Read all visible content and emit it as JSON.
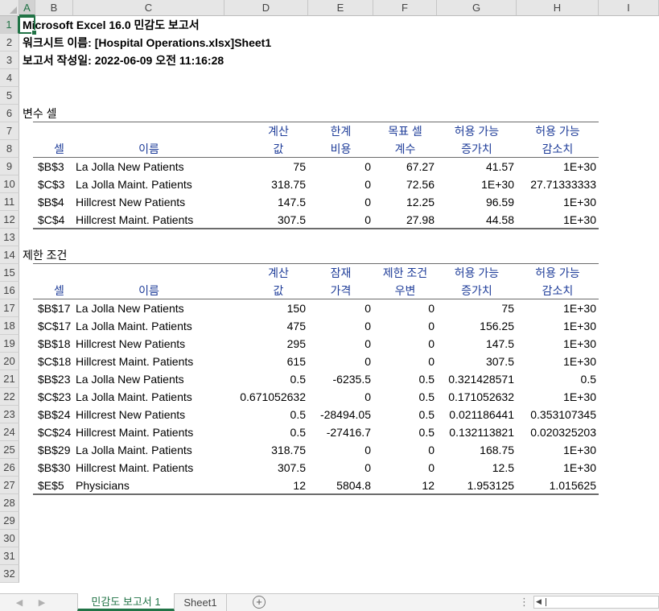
{
  "columns": [
    "A",
    "B",
    "C",
    "D",
    "E",
    "F",
    "G",
    "H",
    "I"
  ],
  "selected_column": "A",
  "selected_row": 1,
  "rows": [
    1,
    2,
    3,
    4,
    5,
    6,
    7,
    8,
    9,
    10,
    11,
    12,
    13,
    14,
    15,
    16,
    17,
    18,
    19,
    20,
    21,
    22,
    23,
    24,
    25,
    26,
    27,
    28,
    29,
    30,
    31,
    32
  ],
  "report": {
    "title": "Microsoft Excel 16.0 민감도 보고서",
    "worksheet": "워크시트 이름: [Hospital Operations.xlsx]Sheet1",
    "created": "보고서 작성일: 2022-06-09 오전 11:16:28"
  },
  "variable_cells": {
    "section_title": "변수 셀",
    "header_top": [
      "",
      "",
      "계산",
      "한계",
      "목표 셀",
      "허용 가능",
      "허용 가능"
    ],
    "header_bottom": [
      "셀",
      "이름",
      "값",
      "비용",
      "계수",
      "증가치",
      "감소치"
    ],
    "rows": [
      [
        "$B$3",
        "La Jolla New Patients",
        "75",
        "0",
        "67.27",
        "41.57",
        "1E+30"
      ],
      [
        "$C$3",
        "La Jolla Maint. Patients",
        "318.75",
        "0",
        "72.56",
        "1E+30",
        "27.71333333"
      ],
      [
        "$B$4",
        "Hillcrest New Patients",
        "147.5",
        "0",
        "12.25",
        "96.59",
        "1E+30"
      ],
      [
        "$C$4",
        "Hillcrest Maint. Patients",
        "307.5",
        "0",
        "27.98",
        "44.58",
        "1E+30"
      ]
    ]
  },
  "constraints": {
    "section_title": "제한 조건",
    "header_top": [
      "",
      "",
      "계산",
      "잠재",
      "제한 조건",
      "허용 가능",
      "허용 가능"
    ],
    "header_bottom": [
      "셀",
      "이름",
      "값",
      "가격",
      "우변",
      "증가치",
      "감소치"
    ],
    "rows": [
      [
        "$B$17",
        "La Jolla New Patients",
        "150",
        "0",
        "0",
        "75",
        "1E+30"
      ],
      [
        "$C$17",
        "La Jolla Maint. Patients",
        "475",
        "0",
        "0",
        "156.25",
        "1E+30"
      ],
      [
        "$B$18",
        "Hillcrest New Patients",
        "295",
        "0",
        "0",
        "147.5",
        "1E+30"
      ],
      [
        "$C$18",
        "Hillcrest Maint. Patients",
        "615",
        "0",
        "0",
        "307.5",
        "1E+30"
      ],
      [
        "$B$23",
        "La Jolla New Patients",
        "0.5",
        "-6235.5",
        "0.5",
        "0.321428571",
        "0.5"
      ],
      [
        "$C$23",
        "La Jolla Maint. Patients",
        "0.671052632",
        "0",
        "0.5",
        "0.171052632",
        "1E+30"
      ],
      [
        "$B$24",
        "Hillcrest New Patients",
        "0.5",
        "-28494.05",
        "0.5",
        "0.021186441",
        "0.353107345"
      ],
      [
        "$C$24",
        "Hillcrest Maint. Patients",
        "0.5",
        "-27416.7",
        "0.5",
        "0.132113821",
        "0.020325203"
      ],
      [
        "$B$29",
        "La Jolla Maint. Patients",
        "318.75",
        "0",
        "0",
        "168.75",
        "1E+30"
      ],
      [
        "$B$30",
        "Hillcrest Maint. Patients",
        "307.5",
        "0",
        "0",
        "12.5",
        "1E+30"
      ],
      [
        "$E$5",
        "Physicians",
        "12",
        "5804.8",
        "12",
        "1.953125",
        "1.015625"
      ]
    ]
  },
  "sheet_tabs": [
    {
      "label": "민감도 보고서 1",
      "active": true
    },
    {
      "label": "Sheet1",
      "active": false
    }
  ],
  "icons": {
    "nav_prev": "prev-sheet-arrow-icon",
    "nav_next": "next-sheet-arrow-icon",
    "add_sheet": "plus-icon",
    "more": "vertical-dots-icon",
    "scroll_left": "scroll-left-arrow-icon"
  },
  "colors": {
    "accent": "#217346",
    "header_text": "#1f3d99",
    "header_bg": "#e6e6e6"
  }
}
